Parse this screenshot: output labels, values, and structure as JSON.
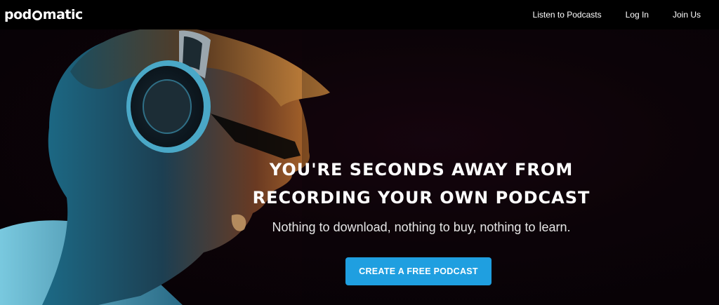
{
  "header": {
    "logo_left": "pod",
    "logo_right": "matic",
    "nav": [
      {
        "label": "Listen to Podcasts"
      },
      {
        "label": "Log In"
      },
      {
        "label": "Join Us"
      }
    ]
  },
  "hero": {
    "headline_line1": "YOU'RE SECONDS AWAY FROM",
    "headline_line2": "RECORDING YOUR OWN PODCAST",
    "subheadline": "Nothing to download, nothing to buy, nothing to learn.",
    "cta_label": "CREATE A FREE PODCAST",
    "photo_subject": "man wearing headphones"
  },
  "colors": {
    "accent": "#1f9fe0",
    "background": "#000000",
    "text": "#ffffff"
  }
}
